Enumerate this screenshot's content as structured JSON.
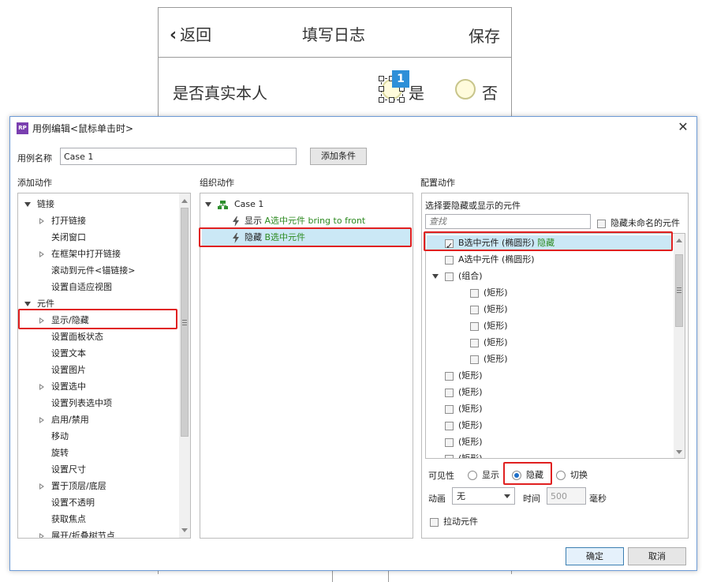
{
  "prototype": {
    "back_label": "返回",
    "title": "填写日志",
    "save_label": "保存",
    "row_label": "是否真实本人",
    "badge": "1",
    "yes_label": "是",
    "no_label": "否"
  },
  "dialog": {
    "title": "用例编辑<鼠标单击时>",
    "case_name_label": "用例名称",
    "case_name_value": "Case 1",
    "add_condition": "添加条件",
    "add_actions_header": "添加动作",
    "organize_header": "组织动作",
    "configure_header": "配置动作",
    "ok": "确定",
    "cancel": "取消"
  },
  "add_actions_tree": [
    {
      "label": "链接",
      "level": 0,
      "toggle": "expanded"
    },
    {
      "label": "打开链接",
      "level": 1,
      "toggle": "collapsed"
    },
    {
      "label": "关闭窗口",
      "level": 1,
      "toggle": "none"
    },
    {
      "label": "在框架中打开链接",
      "level": 1,
      "toggle": "collapsed"
    },
    {
      "label": "滚动到元件<锚链接>",
      "level": 1,
      "toggle": "none"
    },
    {
      "label": "设置自适应视图",
      "level": 1,
      "toggle": "none"
    },
    {
      "label": "元件",
      "level": 0,
      "toggle": "expanded"
    },
    {
      "label": "显示/隐藏",
      "level": 1,
      "toggle": "collapsed"
    },
    {
      "label": "设置面板状态",
      "level": 1,
      "toggle": "none"
    },
    {
      "label": "设置文本",
      "level": 1,
      "toggle": "none"
    },
    {
      "label": "设置图片",
      "level": 1,
      "toggle": "none"
    },
    {
      "label": "设置选中",
      "level": 1,
      "toggle": "collapsed"
    },
    {
      "label": "设置列表选中项",
      "level": 1,
      "toggle": "none"
    },
    {
      "label": "启用/禁用",
      "level": 1,
      "toggle": "collapsed"
    },
    {
      "label": "移动",
      "level": 1,
      "toggle": "none"
    },
    {
      "label": "旋转",
      "level": 1,
      "toggle": "none"
    },
    {
      "label": "设置尺寸",
      "level": 1,
      "toggle": "none"
    },
    {
      "label": "置于顶层/底层",
      "level": 1,
      "toggle": "collapsed"
    },
    {
      "label": "设置不透明",
      "level": 1,
      "toggle": "none"
    },
    {
      "label": "获取焦点",
      "level": 1,
      "toggle": "none"
    },
    {
      "label": "展开/折叠树节点",
      "level": 1,
      "toggle": "collapsed"
    }
  ],
  "organize": {
    "case_label": "Case 1",
    "actions": [
      {
        "verb": "显示",
        "detail": "A选中元件 bring to front"
      },
      {
        "verb": "隐藏",
        "detail": "B选中元件"
      }
    ]
  },
  "configure": {
    "select_label": "选择要隐藏或显示的元件",
    "search_placeholder": "查找",
    "hide_unnamed": "隐藏未命名的元件",
    "widgets": [
      {
        "label": "B选中元件 (椭圆形)",
        "tag": "隐藏",
        "checked": true,
        "level": 0,
        "toggle": "none"
      },
      {
        "label": "A选中元件 (椭圆形)",
        "tag": "",
        "checked": false,
        "level": 0,
        "toggle": "none"
      },
      {
        "label": "(组合)",
        "tag": "",
        "checked": false,
        "level": 0,
        "toggle": "expanded"
      },
      {
        "label": "(矩形)",
        "tag": "",
        "checked": false,
        "level": 1,
        "toggle": "none"
      },
      {
        "label": "(矩形)",
        "tag": "",
        "checked": false,
        "level": 1,
        "toggle": "none"
      },
      {
        "label": "(矩形)",
        "tag": "",
        "checked": false,
        "level": 1,
        "toggle": "none"
      },
      {
        "label": "(矩形)",
        "tag": "",
        "checked": false,
        "level": 1,
        "toggle": "none"
      },
      {
        "label": "(矩形)",
        "tag": "",
        "checked": false,
        "level": 1,
        "toggle": "none"
      },
      {
        "label": "(矩形)",
        "tag": "",
        "checked": false,
        "level": 0,
        "toggle": "none"
      },
      {
        "label": "(矩形)",
        "tag": "",
        "checked": false,
        "level": 0,
        "toggle": "none"
      },
      {
        "label": "(矩形)",
        "tag": "",
        "checked": false,
        "level": 0,
        "toggle": "none"
      },
      {
        "label": "(矩形)",
        "tag": "",
        "checked": false,
        "level": 0,
        "toggle": "none"
      },
      {
        "label": "(矩形)",
        "tag": "",
        "checked": false,
        "level": 0,
        "toggle": "none"
      },
      {
        "label": "(矩形)",
        "tag": "",
        "checked": false,
        "level": 0,
        "toggle": "none"
      }
    ],
    "visibility_label": "可见性",
    "visibility_options": [
      "显示",
      "隐藏",
      "切换"
    ],
    "visibility_selected": "隐藏",
    "animation_label": "动画",
    "animation_value": "无",
    "time_label": "时间",
    "time_value": "500",
    "ms_label": "毫秒",
    "drag_widgets": "拉动元件"
  },
  "colors": {
    "highlight": "#e02020",
    "selected_row": "#cbe8f6",
    "tag_green": "#2e8b22",
    "badge_blue": "#2e8fd8"
  }
}
